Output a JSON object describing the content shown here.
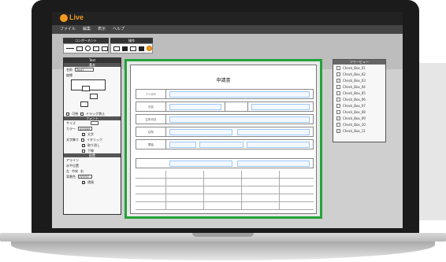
{
  "app": {
    "logo_text": "Live",
    "accent": "#f29a1f",
    "frame_color": "#22a33a"
  },
  "menu": [
    "ファイル",
    "編集",
    "表示",
    "ヘルプ"
  ],
  "toolbar": {
    "components_label": "コンポーネント",
    "operations_label": "操作"
  },
  "left_panel": {
    "title": "Text",
    "section_basic": "基本",
    "name_label": "名前",
    "name_value": "Text1",
    "position_label": "座標",
    "check_visible": "可視",
    "check_drag": "ドラッグ禁止",
    "section_font": "フォント",
    "size_label": "サイズ",
    "color_label": "カラー",
    "color_value": "000000",
    "style_label": "文字飾り",
    "style_bold": "太字",
    "style_italic": "イタリック",
    "style_strike": "取り消し",
    "style_underline": "下線",
    "section_layout": "配置",
    "align_label": "アライン",
    "halign_label": "水平位置",
    "halign_options": [
      "左",
      "中央",
      "右"
    ],
    "bg_label": "背景色",
    "bg_value": "FFFFFF",
    "transparent_label": "透過"
  },
  "form": {
    "title": "申請書",
    "row_labels": [
      "フリガナ",
      "氏名",
      "生年月日",
      "住所",
      "電話"
    ]
  },
  "right_panel": {
    "title": "ツリービュー",
    "items": [
      {
        "label": "Check_Box_01",
        "checked": false
      },
      {
        "label": "Check_Box_02",
        "checked": false
      },
      {
        "label": "Check_Box_03",
        "checked": true
      },
      {
        "label": "Check_Box_04",
        "checked": false
      },
      {
        "label": "Check_Box_05",
        "checked": false
      },
      {
        "label": "Check_Box_06",
        "checked": false
      },
      {
        "label": "Check_Box_07",
        "checked": false
      },
      {
        "label": "Check_Box_08",
        "checked": false
      },
      {
        "label": "Check_Box_09",
        "checked": true
      },
      {
        "label": "Check_Box_10",
        "checked": false
      },
      {
        "label": "Check_Box_11",
        "checked": true
      }
    ]
  }
}
